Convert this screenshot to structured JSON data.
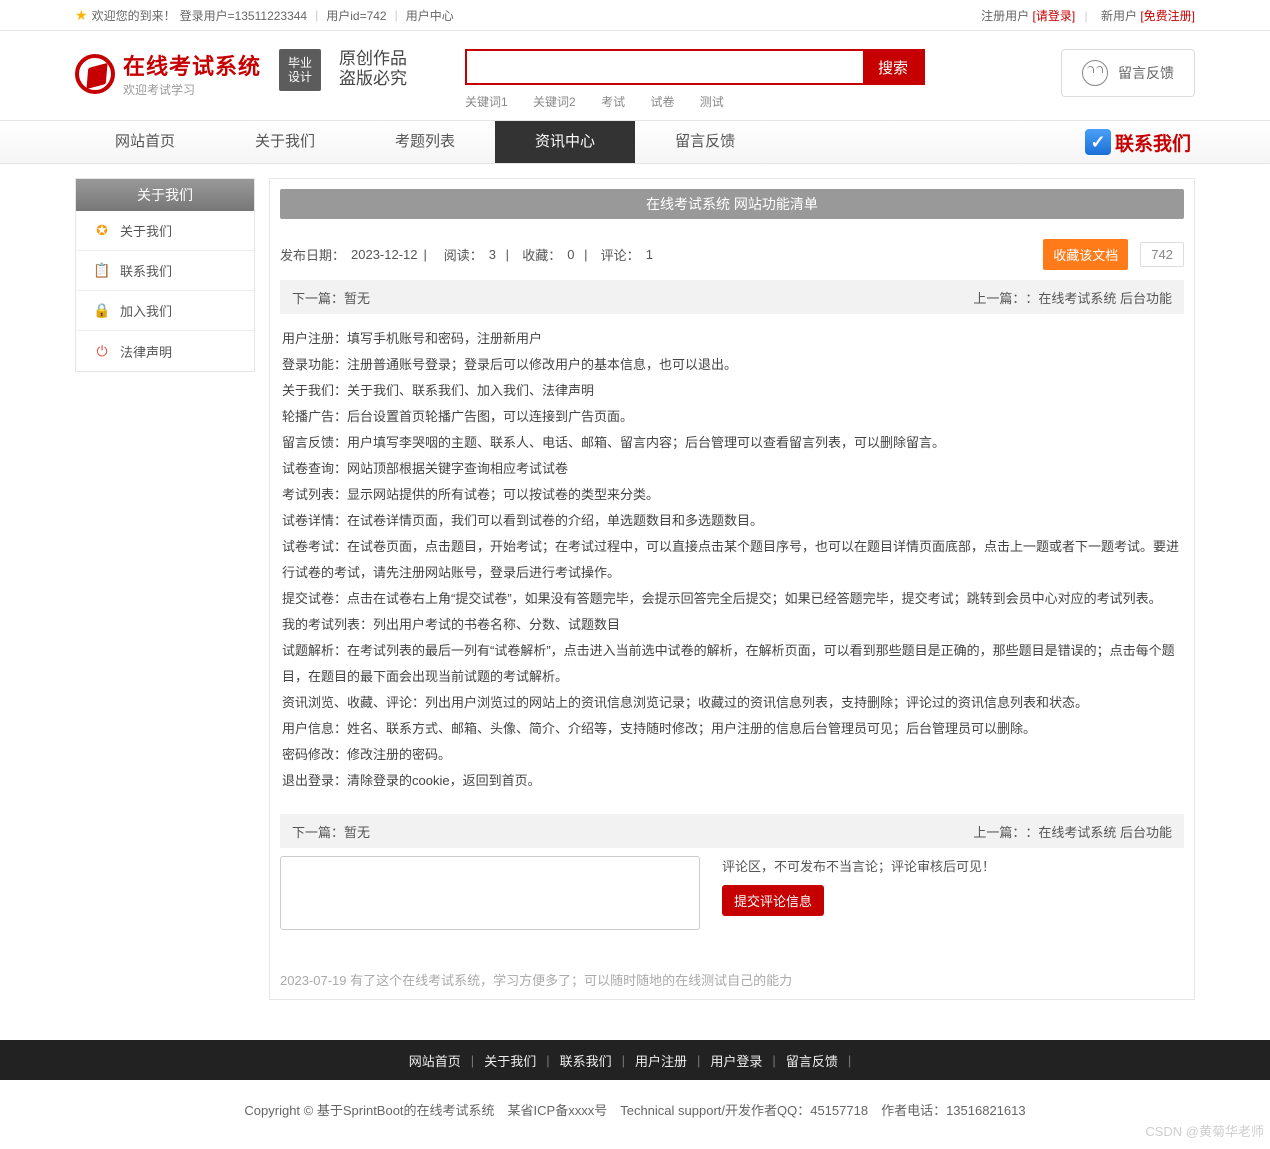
{
  "topbar": {
    "welcome": "欢迎您的到来！",
    "login_user": "登录用户=13511223344",
    "user_id": "用户id=742",
    "user_center": "用户中心",
    "reg_user": "注册用户",
    "please_login": "[请登录]",
    "new_user": "新用户",
    "free_register": "[免费注册]"
  },
  "header": {
    "site_name": "在线考试系统",
    "tagline": "欢迎考试学习",
    "badge_l1": "毕业",
    "badge_l2": "设计",
    "slogan_l1": "原创作品",
    "slogan_l2": "盗版必究",
    "search_btn": "搜索",
    "keywords": [
      "关键词1",
      "关键词2",
      "考试",
      "试卷",
      "测试"
    ],
    "feedback": "留言反馈"
  },
  "nav": {
    "items": [
      "网站首页",
      "关于我们",
      "考题列表",
      "资讯中心",
      "留言反馈"
    ],
    "active_index": 3,
    "contact": "联系我们"
  },
  "sidebar": {
    "title": "关于我们",
    "items": [
      {
        "label": "关于我们",
        "icon": "info",
        "color": "c-orange"
      },
      {
        "label": "联系我们",
        "icon": "contact",
        "color": "c-blue"
      },
      {
        "label": "加入我们",
        "icon": "lock",
        "color": "c-orange"
      },
      {
        "label": "法律声明",
        "icon": "power",
        "color": "c-red"
      }
    ]
  },
  "article": {
    "title": "在线考试系统 网站功能清单",
    "pub_label": "发布日期：",
    "pub_date": "2023-12-12",
    "read_label": "阅读：",
    "read_count": "3",
    "fav_label": "收藏：",
    "fav_count": "0",
    "comment_label": "评论：",
    "comment_count": "1",
    "fav_btn": "收藏该文档",
    "count_742": "742",
    "next_label": "下一篇：",
    "next_value": "暂无",
    "prev_label": "上一篇：",
    "prev_value": "：在线考试系统 后台功能",
    "paragraphs": [
      "用户注册：填写手机账号和密码，注册新用户",
      "登录功能：注册普通账号登录；登录后可以修改用户的基本信息，也可以退出。",
      "关于我们：关于我们、联系我们、加入我们、法律声明",
      "轮播广告：后台设置首页轮播广告图，可以连接到广告页面。",
      "留言反馈：用户填写李哭咽的主题、联系人、电话、邮箱、留言内容；后台管理可以查看留言列表，可以删除留言。",
      "试卷查询：网站顶部根据关键字查询相应考试试卷",
      "考试列表：显示网站提供的所有试卷；可以按试卷的类型来分类。",
      "试卷详情：在试卷详情页面，我们可以看到试卷的介绍，单选题数目和多选题数目。",
      "试卷考试：在试卷页面，点击题目，开始考试；在考试过程中，可以直接点击某个题目序号，也可以在题目详情页面底部，点击上一题或者下一题考试。要进行试卷的考试，请先注册网站账号，登录后进行考试操作。",
      "提交试卷：点击在试卷右上角“提交试卷”，如果没有答题完毕，会提示回答完全后提交；如果已经答题完毕，提交考试；跳转到会员中心对应的考试列表。",
      "我的考试列表：列出用户考试的书卷名称、分数、试题数目",
      "试题解析：在考试列表的最后一列有“试卷解析”，点击进入当前选中试卷的解析，在解析页面，可以看到那些题目是正确的，那些题目是错误的；点击每个题目，在题目的最下面会出现当前试题的考试解析。",
      "资讯浏览、收藏、评论：列出用户浏览过的网站上的资讯信息浏览记录；收藏过的资讯信息列表，支持删除；评论过的资讯信息列表和状态。",
      "用户信息：姓名、联系方式、邮箱、头像、简介、介绍等，支持随时修改；用户注册的信息后台管理员可见；后台管理员可以删除。",
      "密码修改：修改注册的密码。",
      "退出登录：清除登录的cookie，返回到首页。"
    ]
  },
  "comment": {
    "tip": "评论区，不可发布不当言论；评论审核后可见！",
    "submit": "提交评论信息",
    "existing": "2023-07-19 有了这个在线考试系统，学习方便多了；可以随时随地的在线测试自己的能力"
  },
  "footer": {
    "links": [
      "网站首页",
      "关于我们",
      "联系我们",
      "用户注册",
      "用户登录",
      "留言反馈"
    ],
    "info": "Copyright © 基于SprintBoot的在线考试系统　某省ICP备xxxx号　Technical support/开发作者QQ：45157718　作者电话：13516821613"
  },
  "watermark": "CSDN @黄菊华老师"
}
